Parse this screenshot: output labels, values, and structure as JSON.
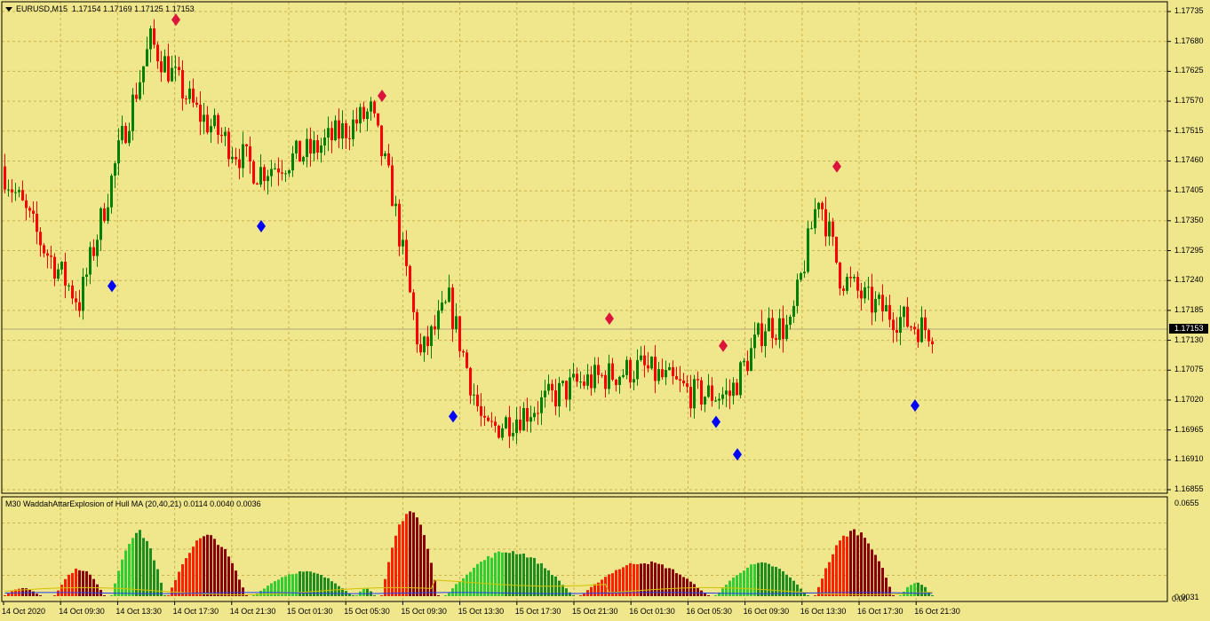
{
  "chart_header": {
    "symbol_tf": "EURUSD,M15",
    "ohlc": "1.17154 1.17169 1.17125 1.17153"
  },
  "indicator_header": {
    "text": "M30  WaddahAttarExplosion of Hull MA (20,40,21) 0.0114 0.0040 0.0036"
  },
  "colors": {
    "background": "#f0e68c",
    "grid": "#c8b450",
    "bull": "#008000",
    "bear": "#ff0000",
    "signal_sell": "#dc143c",
    "signal_buy": "#0000ff",
    "wae_up": "#32cd32",
    "wae_up_dim": "#1e8c1e",
    "wae_down": "#ff2000",
    "wae_down_dim": "#8b0000"
  },
  "price_axis": {
    "ticks": [
      "1.17735",
      "1.17680",
      "1.17625",
      "1.17570",
      "1.17515",
      "1.17460",
      "1.17405",
      "1.17350",
      "1.17295",
      "1.17240",
      "1.17185",
      "1.17130",
      "1.17075",
      "1.17020",
      "1.16965",
      "1.16910",
      "1.16855"
    ],
    "current_price": "1.17153"
  },
  "indicator_axis": {
    "top_value": "0.0655",
    "bottom_value_a": "0.0031",
    "bottom_value_b": "0.00"
  },
  "time_axis": {
    "labels": [
      "14 Oct 2020",
      "14 Oct 09:30",
      "14 Oct 13:30",
      "14 Oct 17:30",
      "14 Oct 21:30",
      "15 Oct 01:30",
      "15 Oct 05:30",
      "15 Oct 09:30",
      "15 Oct 13:30",
      "15 Oct 17:30",
      "15 Oct 21:30",
      "16 Oct 01:30",
      "16 Oct 05:30",
      "16 Oct 09:30",
      "16 Oct 13:30",
      "16 Oct 17:30",
      "16 Oct 21:30"
    ]
  },
  "chart_data": {
    "type": "candlestick",
    "symbol": "EURUSD",
    "timeframe": "M15",
    "ylim": [
      1.16855,
      1.1775
    ],
    "price_keypoints": [
      {
        "bar": 0,
        "price": 1.1745
      },
      {
        "bar": 12,
        "price": 1.173
      },
      {
        "bar": 22,
        "price": 1.172
      },
      {
        "bar": 34,
        "price": 1.175
      },
      {
        "bar": 42,
        "price": 1.1768
      },
      {
        "bar": 55,
        "price": 1.1755
      },
      {
        "bar": 72,
        "price": 1.1744
      },
      {
        "bar": 88,
        "price": 1.1748
      },
      {
        "bar": 104,
        "price": 1.1755
      },
      {
        "bar": 110,
        "price": 1.174
      },
      {
        "bar": 118,
        "price": 1.171
      },
      {
        "bar": 126,
        "price": 1.172
      },
      {
        "bar": 136,
        "price": 1.1696
      },
      {
        "bar": 148,
        "price": 1.17
      },
      {
        "bar": 162,
        "price": 1.1705
      },
      {
        "bar": 180,
        "price": 1.1708
      },
      {
        "bar": 195,
        "price": 1.1703
      },
      {
        "bar": 205,
        "price": 1.1703
      },
      {
        "bar": 215,
        "price": 1.1716
      },
      {
        "bar": 222,
        "price": 1.1715
      },
      {
        "bar": 230,
        "price": 1.174
      },
      {
        "bar": 236,
        "price": 1.1725
      },
      {
        "bar": 244,
        "price": 1.172
      },
      {
        "bar": 256,
        "price": 1.1716
      },
      {
        "bar": 261,
        "price": 1.1715
      }
    ],
    "signals": [
      {
        "type": "sell",
        "time": "14 Oct 14:30",
        "price": 1.1772
      },
      {
        "type": "buy",
        "time": "14 Oct 09:45",
        "price": 1.1723
      },
      {
        "type": "buy",
        "time": "14 Oct 19:30",
        "price": 1.1734
      },
      {
        "type": "sell",
        "time": "15 Oct 04:45",
        "price": 1.1758
      },
      {
        "type": "buy",
        "time": "15 Oct 09:45",
        "price": 1.1699
      },
      {
        "type": "sell",
        "time": "15 Oct 20:30",
        "price": 1.1717
      },
      {
        "type": "sell",
        "time": "16 Oct 04:15",
        "price": 1.1712
      },
      {
        "type": "buy",
        "time": "16 Oct 03:45",
        "price": 1.1698
      },
      {
        "type": "buy",
        "time": "16 Oct 05:15",
        "price": 1.1692
      },
      {
        "type": "sell",
        "time": "16 Oct 15:30",
        "price": 1.1745
      },
      {
        "type": "buy",
        "time": "16 Oct 20:00",
        "price": 1.1701
      }
    ],
    "indicator": {
      "name": "WaddahAttarExplosion of Hull MA",
      "params": [
        20,
        40,
        21
      ],
      "values": [
        0.0114,
        0.004,
        0.0036
      ],
      "ylim": [
        0,
        0.0655
      ],
      "humps": [
        {
          "from": 0,
          "to": 10,
          "dir": "down",
          "peak": 0.006
        },
        {
          "from": 14,
          "to": 28,
          "dir": "down",
          "peak": 0.02
        },
        {
          "from": 30,
          "to": 45,
          "dir": "up",
          "peak": 0.047
        },
        {
          "from": 46,
          "to": 68,
          "dir": "down",
          "peak": 0.044
        },
        {
          "from": 70,
          "to": 98,
          "dir": "up",
          "peak": 0.018
        },
        {
          "from": 99,
          "to": 104,
          "dir": "up",
          "peak": 0.006
        },
        {
          "from": 106,
          "to": 122,
          "dir": "down",
          "peak": 0.063
        },
        {
          "from": 124,
          "to": 160,
          "dir": "up",
          "peak": 0.033
        },
        {
          "from": 162,
          "to": 198,
          "dir": "down",
          "peak": 0.025
        },
        {
          "from": 200,
          "to": 226,
          "dir": "up",
          "peak": 0.024
        },
        {
          "from": 228,
          "to": 250,
          "dir": "down",
          "peak": 0.048
        },
        {
          "from": 252,
          "to": 261,
          "dir": "up",
          "peak": 0.01
        }
      ]
    }
  }
}
